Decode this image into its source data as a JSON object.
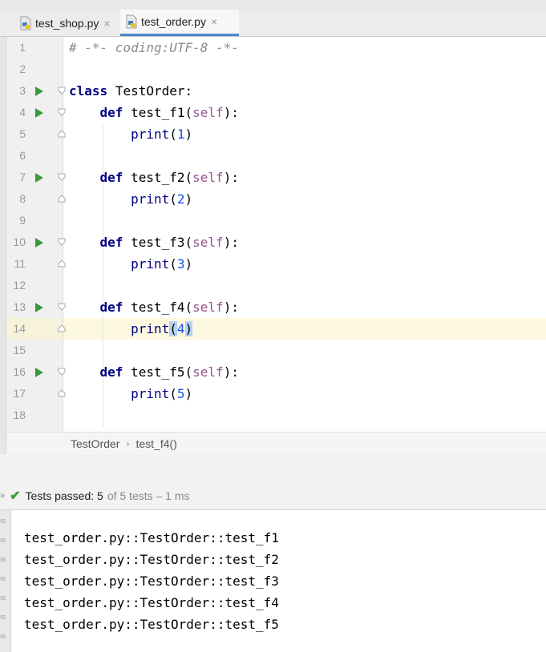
{
  "tabs": [
    {
      "label": "test_shop.py",
      "active": false
    },
    {
      "label": "test_order.py",
      "active": true
    }
  ],
  "tab_close_glyph": "×",
  "line_numbers": [
    "1",
    "2",
    "3",
    "4",
    "5",
    "6",
    "7",
    "8",
    "9",
    "10",
    "11",
    "12",
    "13",
    "14",
    "15",
    "16",
    "17",
    "18"
  ],
  "code": {
    "line1": "# -*- coding:UTF-8 -*-",
    "class_kw": "class",
    "class_name": "TestOrder:",
    "def_kw": "def",
    "self_kw": "self",
    "print_kw": "print",
    "methods": [
      {
        "name": "test_f1",
        "arg": "1"
      },
      {
        "name": "test_f2",
        "arg": "2"
      },
      {
        "name": "test_f3",
        "arg": "3"
      },
      {
        "name": "test_f4",
        "arg": "4"
      },
      {
        "name": "test_f5",
        "arg": "5"
      }
    ]
  },
  "breadcrumb": {
    "class": "TestOrder",
    "separator": "›",
    "method": "test_f4()"
  },
  "test_bar": {
    "chevron": "»",
    "passed_label": "Tests passed: 5",
    "detail": "of 5 tests – 1 ms"
  },
  "output_lines": [
    "test_order.py::TestOrder::test_f1",
    "test_order.py::TestOrder::test_f2",
    "test_order.py::TestOrder::test_f3",
    "test_order.py::TestOrder::test_f4",
    "test_order.py::TestOrder::test_f5"
  ],
  "left_ticks": [
    "ıs",
    "ıs",
    "ıs",
    "ıs",
    "ıs",
    "ıs",
    "ıs"
  ],
  "colors": {
    "run": "#3a9a3a",
    "accent": "#4a88c7",
    "keyword": "#000080",
    "self": "#94558d",
    "number": "#1750eb"
  }
}
